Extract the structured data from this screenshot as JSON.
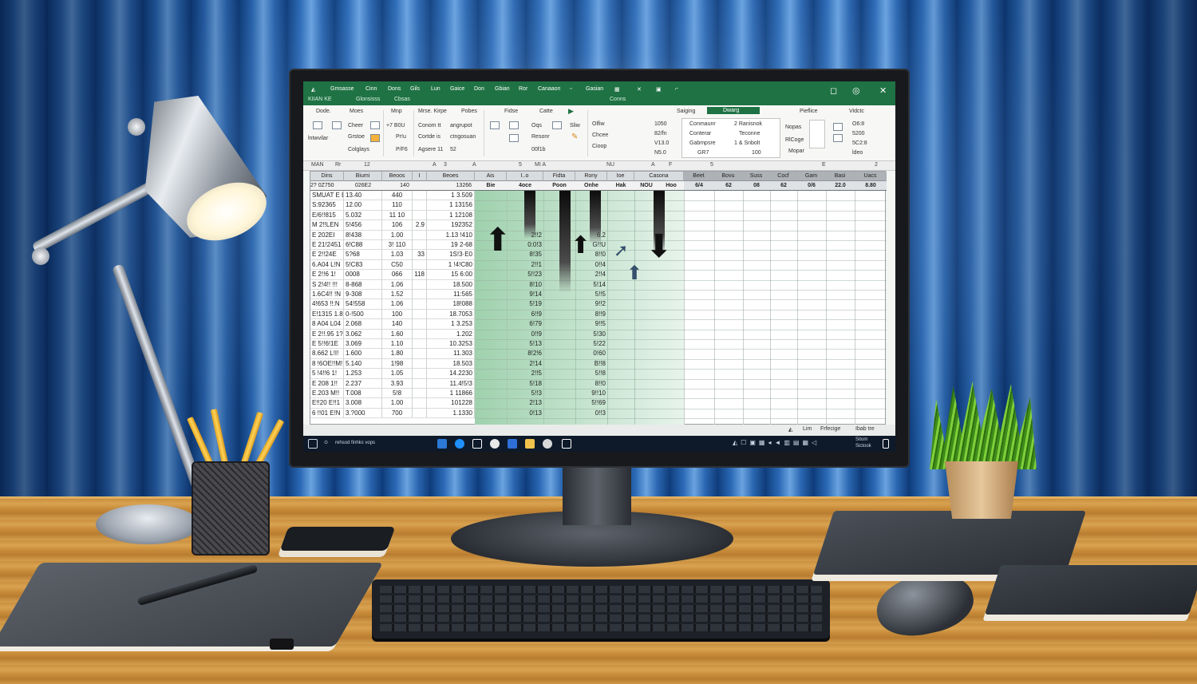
{
  "titlebar": {
    "menu": [
      "Gmsasse",
      "Cinn",
      "Dons",
      "Gils",
      "Lun",
      "Gaice",
      "Don",
      "Gbian",
      "Ror",
      "Canaaon",
      "Gasian"
    ],
    "row2": [
      "KIIAN KE",
      "Glonsisss",
      "Cbsas",
      "Conns"
    ]
  },
  "ribbon": {
    "tabs": [
      "Dode.",
      "Moes",
      "Mnp",
      "Mrse. Kirpe",
      "Pobes",
      "Fidse",
      "Catte",
      "Saiging",
      "Dwarg",
      "Pieflice",
      "Vidctc"
    ],
    "group1": [
      "Cheer",
      "Grstoe",
      "Colglays",
      "lntwvilar"
    ],
    "group2": [
      "+7 B0U",
      "Pr!u",
      "P/F6"
    ],
    "group3": [
      "Conom tt",
      "angrupot",
      "Cortde is",
      "ctngosuan",
      "Agsere 11",
      "52"
    ],
    "group4": [
      "Oqs",
      "Resonr",
      "00f1b"
    ],
    "group5": [
      "Sliw",
      "Olfiw",
      "Chcee",
      "Cioop"
    ],
    "group6": [
      "1050",
      "82/fn",
      "V13.0",
      "N5.0"
    ],
    "group7": [
      "Conmaunr",
      "Conterar",
      "Gabmpsre",
      "GR7"
    ],
    "group8": [
      "2 Ranisnok",
      "Teconne",
      "1 & Snbolt",
      "100"
    ],
    "group9": [
      "Nopas",
      "RlCoge",
      "Mopar"
    ],
    "group10": [
      "O6:8",
      "5200",
      "5C2:8",
      "ldeo"
    ]
  },
  "formulabar": [
    "MAN",
    "Rr",
    "12",
    "A",
    "3",
    "A",
    "5",
    "MI A",
    "NU",
    "A",
    "F",
    "5",
    "E",
    "2"
  ],
  "grid": {
    "headers_left": [
      "Dins",
      "Biumi",
      "Beoos",
      "I",
      "Beoes"
    ],
    "headers_mid": [
      "Ais",
      "I..o",
      "Fidta",
      "Rony",
      "Ioe",
      "Casona"
    ],
    "headers_right": [
      "Beet",
      "Bovu",
      "Suss",
      "Cocf",
      "Gam",
      "Basi",
      "Uacs"
    ],
    "sub_mid": [
      "Bie",
      "4oce",
      "Poon",
      "Onhe",
      "Hak",
      "NOU",
      "Hoo"
    ],
    "sub_right": [
      "6/4",
      "62",
      "08",
      "62",
      "0/6",
      "22.0",
      "8.80"
    ],
    "top_row": [
      "2? 0Z750",
      "026E2",
      "140",
      "13266"
    ],
    "rows": [
      [
        "SMUAT E E",
        "13.40",
        "440",
        "",
        "1 3.509"
      ],
      [
        "S:92365",
        "12.00",
        "110",
        "",
        "1 13156"
      ],
      [
        "E/6!!815",
        "5.032",
        "11 10",
        "",
        "1 12108"
      ],
      [
        "M 2!!LEN",
        "5!456",
        "106",
        "2.9",
        "192352"
      ],
      [
        "E 202EI",
        "8!438",
        "1.00",
        "",
        "1.13 !410"
      ],
      [
        "E 21!2451",
        "6!C88",
        "3! 110",
        "",
        "19 2-68"
      ],
      [
        "E 2!!24E",
        "5?68",
        "1.03",
        "33",
        "1S!3·E0"
      ],
      [
        "6.A04 L!N",
        "5!C83",
        "C50",
        "",
        "1 !4!C80"
      ],
      [
        "E 2!!6 1!",
        "0008",
        "066",
        "118",
        "15 6:00"
      ],
      [
        "S 2!4!! !!!",
        "8-868",
        "1.06",
        "",
        "18.500"
      ],
      [
        "1.6C4!! !N",
        "9-308",
        "1.52",
        "",
        "11:565"
      ],
      [
        "4!653 !!:N",
        "54!558",
        "1.06",
        "",
        "18!088"
      ],
      [
        "E!1315 1.8",
        "0-!500",
        "100",
        "",
        "18.7053"
      ],
      [
        "8 A04 L04",
        "2.068",
        "140",
        "",
        "1 3.253"
      ],
      [
        "E 2!!.95 1?",
        "3.062",
        "1.60",
        "",
        "1.202"
      ],
      [
        "E 5!!6!1E",
        "3.069",
        "1.10",
        "",
        "10.3253"
      ],
      [
        "8.662 L!I!",
        "1.600",
        "1.80",
        "",
        "11.303"
      ],
      [
        "8 !6OE!!M!",
        "5.140",
        "1!98",
        "",
        "18.503"
      ],
      [
        "5 !4!!6 1!",
        "1.253",
        "1.05",
        "",
        "14.2230"
      ],
      [
        "E 208 1!!",
        "2.237",
        "3.93",
        "",
        "11.4!5!3"
      ],
      [
        "E.203 M!!",
        "T.008",
        "5!8",
        "",
        "1 11866"
      ],
      [
        "E!!20 E!!1",
        "3.008",
        "1.00",
        "",
        "101228"
      ],
      [
        "6 !!01 E!N",
        "3.?000",
        "700",
        "",
        "1.1330"
      ]
    ],
    "mid_col_a": [
      "2!!2",
      "0:0!3",
      "8!35",
      "2!!1",
      "5!!23",
      "8!10",
      "9!14",
      "5!19",
      "6!!9",
      "6!79",
      "0!!9",
      "5!13",
      "8!2!6",
      "2!14",
      "2!!5",
      "5!18",
      "5!!3",
      "2!13",
      "0!13"
    ],
    "mid_col_b": [
      "6.2",
      "G!!U",
      "8!!0",
      "0!!4",
      "2!!4",
      "5!14",
      "5!!5",
      "9!!2",
      "8!!9",
      "9!!5",
      "5!30",
      "5!22",
      "0!60",
      "B!!8",
      "5!!8",
      "8!!0",
      "9!!10",
      "5!!69",
      "0!!3"
    ]
  },
  "statusbar": [
    "Lim",
    "Frfecige",
    "Ibab tre"
  ],
  "taskbar": {
    "search": "rehsod finhks vops",
    "clock": "Sitom\nSictook"
  }
}
